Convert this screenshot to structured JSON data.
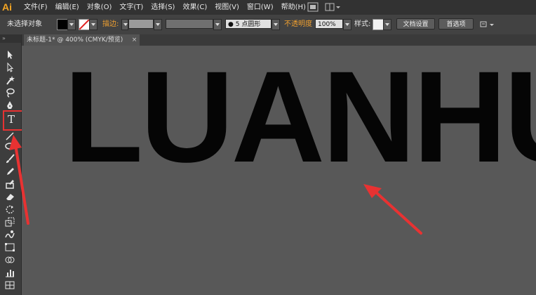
{
  "app": {
    "logo": "Ai"
  },
  "menu": [
    "文件(F)",
    "编辑(E)",
    "对象(O)",
    "文字(T)",
    "选择(S)",
    "效果(C)",
    "视图(V)",
    "窗口(W)",
    "帮助(H)"
  ],
  "control_bar": {
    "selection_status": "未选择对象",
    "stroke_label": "描边:",
    "brush_size": "5",
    "brush_name": "点圆形",
    "opacity_label": "不透明度",
    "opacity_value": "100%",
    "style_label": "样式:",
    "doc_setup_button": "文档设置",
    "preferences_button": "首选项"
  },
  "document_tab": {
    "title": "未标题-1* @ 400% (CMYK/预览)",
    "close": "×"
  },
  "toolbar": {
    "grip": "»",
    "type_tool_glyph": "T"
  },
  "canvas": {
    "text": "LUANHU"
  },
  "colors": {
    "accent_highlight": "#e83232",
    "ai_logo": "#f5a623",
    "stroke_label": "#f0a030"
  }
}
